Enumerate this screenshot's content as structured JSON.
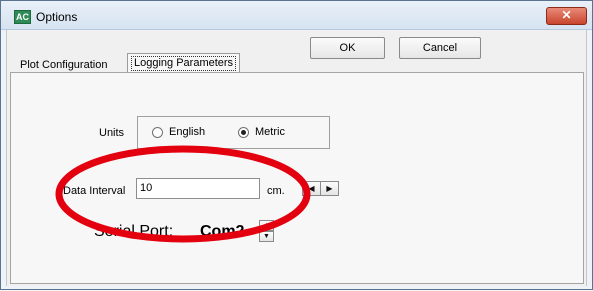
{
  "window": {
    "title": "Options",
    "app_icon_text": "AC",
    "close_glyph": "✕"
  },
  "buttons": {
    "ok_label": "OK",
    "cancel_label": "Cancel"
  },
  "tabs": [
    {
      "label": "Plot Configuration",
      "selected": false
    },
    {
      "label": "Logging Parameters",
      "selected": true
    }
  ],
  "units": {
    "label": "Units",
    "options": [
      {
        "label": "English",
        "checked": false
      },
      {
        "label": "Metric",
        "checked": true
      }
    ]
  },
  "data_interval": {
    "label": "Data Interval",
    "value": "10",
    "unit": "cm.",
    "spin_left_glyph": "◀",
    "spin_right_glyph": "▶"
  },
  "serial_port": {
    "label": "Serial Port:",
    "value": "Com2",
    "spin_up_glyph": "▲",
    "spin_down_glyph": "▼"
  },
  "annotation": {
    "shape": "ellipse",
    "color": "#e3000f",
    "stroke": "#e3000f"
  },
  "colors": {
    "close_button": "#c9452d",
    "window_border": "#5c7390"
  }
}
